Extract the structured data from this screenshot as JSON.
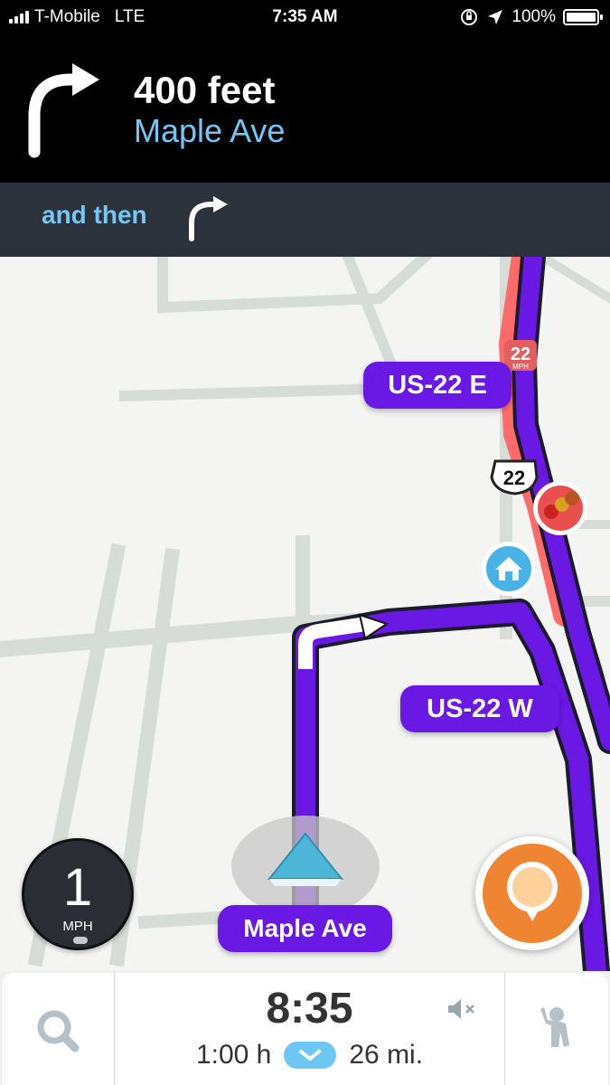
{
  "status_bar": {
    "carrier": "T-Mobile",
    "network": "LTE",
    "time": "7:35 AM",
    "battery": "100%",
    "icons": [
      "signal-bars-icon",
      "orientation-lock-icon",
      "location-arrow-icon",
      "battery-icon"
    ]
  },
  "navigation": {
    "distance": "400 feet",
    "street": "Maple Ave",
    "turn_icon": "turn-right-arrow-icon",
    "then_label": "and then",
    "then_icon": "turn-right-arrow-icon"
  },
  "map": {
    "route_labels": {
      "us22e": "US-22 E",
      "us22w": "US-22 W"
    },
    "current_street": "Maple Ave",
    "speed_limit_sign": {
      "value": "22",
      "unit": "MPH"
    },
    "highway_shield": "22",
    "markers": [
      "traffic-jam-icon",
      "home-icon",
      "position-arrow-icon"
    ],
    "colors": {
      "route": "#6a18e3",
      "traffic": "#ff6b6b",
      "position": "#4db6d8"
    }
  },
  "speedometer": {
    "value": "1",
    "unit": "MPH"
  },
  "report_button": {
    "icon": "report-pin-icon"
  },
  "bottom_bar": {
    "eta": "8:35",
    "duration": "1:00 h",
    "distance": "26 mi.",
    "icons": [
      "search-icon",
      "mute-sound-icon",
      "chevron-down-icon",
      "waze-character-icon"
    ]
  }
}
